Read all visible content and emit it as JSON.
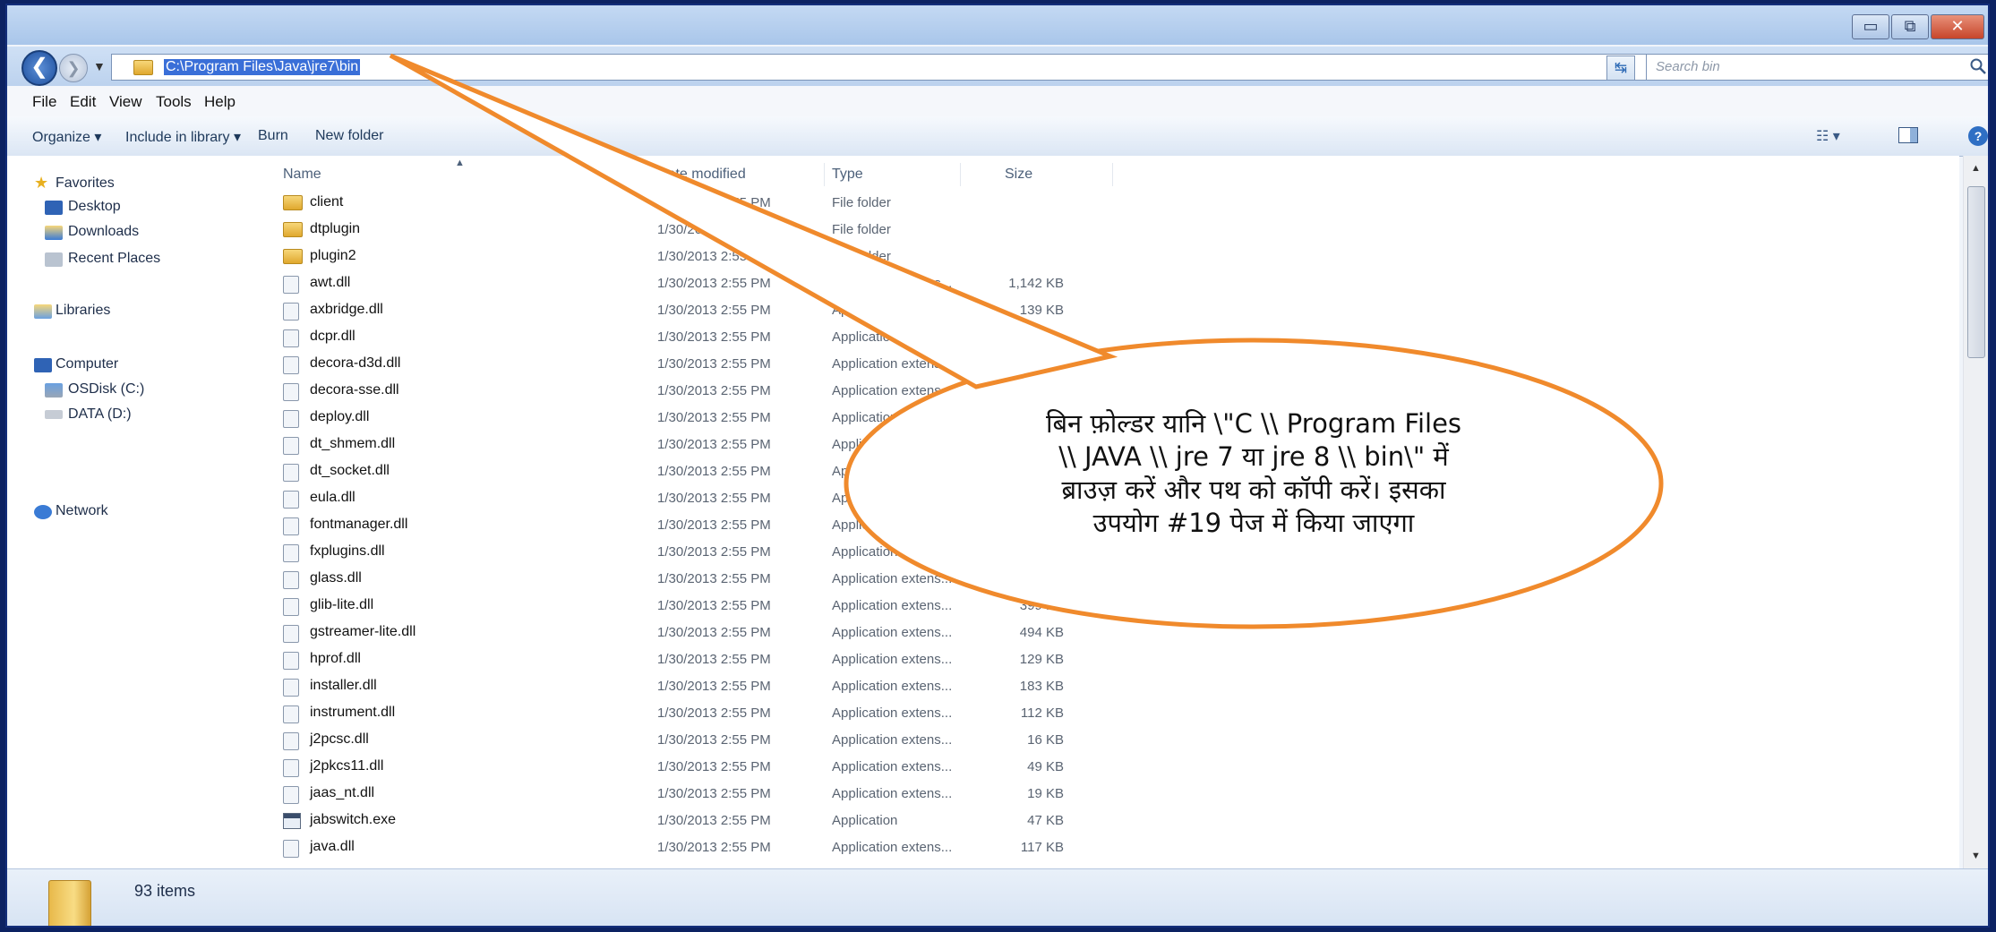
{
  "window": {
    "controls": {
      "minimize": "▭",
      "maximize": "⧉",
      "close": "✕"
    }
  },
  "address": {
    "path": "C:\\Program Files\\Java\\jre7\\bin",
    "search_placeholder": "Search bin",
    "back": "❮",
    "forward": "❯",
    "dropdown": "▼",
    "refresh": "↹"
  },
  "menu": [
    "File",
    "Edit",
    "View",
    "Tools",
    "Help"
  ],
  "toolbar": {
    "organize": "Organize ▾",
    "include": "Include in library ▾",
    "burn": "Burn",
    "new_folder": "New folder",
    "views_icon": "☷ ▾",
    "help": "?"
  },
  "nav": {
    "favorites": "Favorites",
    "desktop": "Desktop",
    "downloads": "Downloads",
    "recent": "Recent Places",
    "libraries": "Libraries",
    "computer": "Computer",
    "osdisk": "OSDisk (C:)",
    "data": "DATA (D:)",
    "network": "Network"
  },
  "columns": {
    "name": "Name",
    "date": "Date modified",
    "type": "Type",
    "size": "Size"
  },
  "files": [
    {
      "name": "client",
      "date": "1/30/2013 2:55 PM",
      "type": "File folder",
      "size": "",
      "kind": "folder"
    },
    {
      "name": "dtplugin",
      "date": "1/30/2013 2:55 PM",
      "type": "File folder",
      "size": "",
      "kind": "folder"
    },
    {
      "name": "plugin2",
      "date": "1/30/2013 2:55 PM",
      "type": "File folder",
      "size": "",
      "kind": "folder"
    },
    {
      "name": "awt.dll",
      "date": "1/30/2013 2:55 PM",
      "type": "Application extens...",
      "size": "1,142 KB",
      "kind": "dll"
    },
    {
      "name": "axbridge.dll",
      "date": "1/30/2013 2:55 PM",
      "type": "Application extens...",
      "size": "139 KB",
      "kind": "dll"
    },
    {
      "name": "dcpr.dll",
      "date": "1/30/2013 2:55 PM",
      "type": "Application extens...",
      "size": "",
      "kind": "dll"
    },
    {
      "name": "decora-d3d.dll",
      "date": "1/30/2013 2:55 PM",
      "type": "Application extens...",
      "size": "",
      "kind": "dll"
    },
    {
      "name": "decora-sse.dll",
      "date": "1/30/2013 2:55 PM",
      "type": "Application extens...",
      "size": "",
      "kind": "dll"
    },
    {
      "name": "deploy.dll",
      "date": "1/30/2013 2:55 PM",
      "type": "Application extens...",
      "size": "",
      "kind": "dll"
    },
    {
      "name": "dt_shmem.dll",
      "date": "1/30/2013 2:55 PM",
      "type": "Application extens...",
      "size": "",
      "kind": "dll"
    },
    {
      "name": "dt_socket.dll",
      "date": "1/30/2013 2:55 PM",
      "type": "Application extens...",
      "size": "",
      "kind": "dll"
    },
    {
      "name": "eula.dll",
      "date": "1/30/2013 2:55 PM",
      "type": "Application extens...",
      "size": "",
      "kind": "dll"
    },
    {
      "name": "fontmanager.dll",
      "date": "1/30/2013 2:55 PM",
      "type": "Application extens...",
      "size": "",
      "kind": "dll"
    },
    {
      "name": "fxplugins.dll",
      "date": "1/30/2013 2:55 PM",
      "type": "Application extens...",
      "size": "",
      "kind": "dll"
    },
    {
      "name": "glass.dll",
      "date": "1/30/2013 2:55 PM",
      "type": "Application extens...",
      "size": "",
      "kind": "dll"
    },
    {
      "name": "glib-lite.dll",
      "date": "1/30/2013 2:55 PM",
      "type": "Application extens...",
      "size": "399 KB",
      "kind": "dll"
    },
    {
      "name": "gstreamer-lite.dll",
      "date": "1/30/2013 2:55 PM",
      "type": "Application extens...",
      "size": "494 KB",
      "kind": "dll"
    },
    {
      "name": "hprof.dll",
      "date": "1/30/2013 2:55 PM",
      "type": "Application extens...",
      "size": "129 KB",
      "kind": "dll"
    },
    {
      "name": "installer.dll",
      "date": "1/30/2013 2:55 PM",
      "type": "Application extens...",
      "size": "183 KB",
      "kind": "dll"
    },
    {
      "name": "instrument.dll",
      "date": "1/30/2013 2:55 PM",
      "type": "Application extens...",
      "size": "112 KB",
      "kind": "dll"
    },
    {
      "name": "j2pcsc.dll",
      "date": "1/30/2013 2:55 PM",
      "type": "Application extens...",
      "size": "16 KB",
      "kind": "dll"
    },
    {
      "name": "j2pkcs11.dll",
      "date": "1/30/2013 2:55 PM",
      "type": "Application extens...",
      "size": "49 KB",
      "kind": "dll"
    },
    {
      "name": "jaas_nt.dll",
      "date": "1/30/2013 2:55 PM",
      "type": "Application extens...",
      "size": "19 KB",
      "kind": "dll"
    },
    {
      "name": "jabswitch.exe",
      "date": "1/30/2013 2:55 PM",
      "type": "Application",
      "size": "47 KB",
      "kind": "exe"
    },
    {
      "name": "java.dll",
      "date": "1/30/2013 2:55 PM",
      "type": "Application extens...",
      "size": "117 KB",
      "kind": "dll"
    }
  ],
  "status": {
    "count": "93 items"
  },
  "callout": {
    "lines": [
      "बिन फ़ोल्डर यानि \\\"C \\\\ Program Files",
      "\\\\ JAVA \\\\ jre 7 या jre 8 \\\\ bin\\\" में",
      "ब्राउज़ करें और पथ को कॉपी करें। इसका",
      "उपयोग #19 पेज में किया जाएगा"
    ]
  },
  "colors": {
    "accent": "#f08a2c",
    "address_highlight": "#3a6fd8",
    "frame": "#0c2262"
  }
}
